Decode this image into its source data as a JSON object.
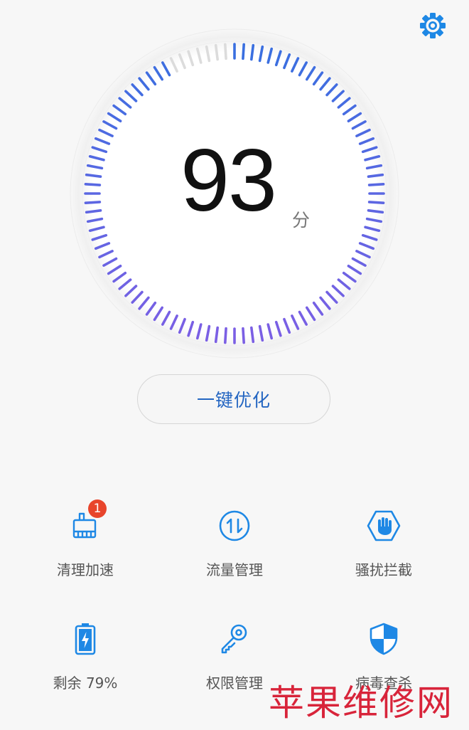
{
  "header": {
    "settings_icon": "gear-icon"
  },
  "score": {
    "value": "93",
    "unit": "分",
    "progress_fraction": 0.93
  },
  "optimize": {
    "label": "一键优化"
  },
  "tools": [
    {
      "label": "清理加速",
      "icon": "broom-clean-icon",
      "badge": "1"
    },
    {
      "label": "流量管理",
      "icon": "data-traffic-icon"
    },
    {
      "label": "骚扰拦截",
      "icon": "hand-block-icon"
    },
    {
      "label": "剩余 79%",
      "icon": "battery-icon"
    },
    {
      "label": "权限管理",
      "icon": "key-icon"
    },
    {
      "label": "病毒查杀",
      "icon": "shield-icon"
    }
  ],
  "watermark": {
    "text": "苹果维修网"
  },
  "colors": {
    "accent": "#1e88e5",
    "gauge_top": "#3a6fe0",
    "gauge_bottom": "#7b5fe4",
    "gauge_inactive": "#dcdcdc",
    "badge": "#e8452c",
    "button_text": "#2466c2",
    "watermark": "#d8243a"
  }
}
